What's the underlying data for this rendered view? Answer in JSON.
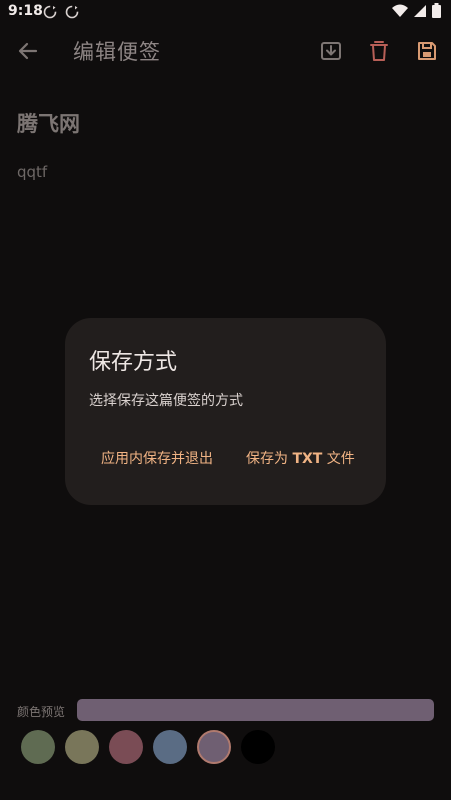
{
  "status_bar": {
    "time": "9:18"
  },
  "app_bar": {
    "title": "编辑便签",
    "icons": [
      "arrow-back-icon",
      "import-icon",
      "delete-icon",
      "save-icon"
    ]
  },
  "note": {
    "title": "腾飞网",
    "body": "qqtf"
  },
  "dialog": {
    "title": "保存方式",
    "message": "选择保存这篇便签的方式",
    "action_in_app": "应用内保存并退出",
    "action_txt_prefix": "保存为 ",
    "action_txt_bold": "TXT",
    "action_txt_suffix": " 文件"
  },
  "color_preview": {
    "label": "颜色预览",
    "preview_color": "#6f5f72",
    "swatches": [
      "#5f6b52",
      "#79765a",
      "#7a4c55",
      "#5a6c84",
      "#6f5f72",
      "#000000"
    ],
    "selected_index": 4
  },
  "colors": {
    "background": "#0f0d0d",
    "dialog_background": "#221e1d",
    "accent": "#f0b384"
  }
}
